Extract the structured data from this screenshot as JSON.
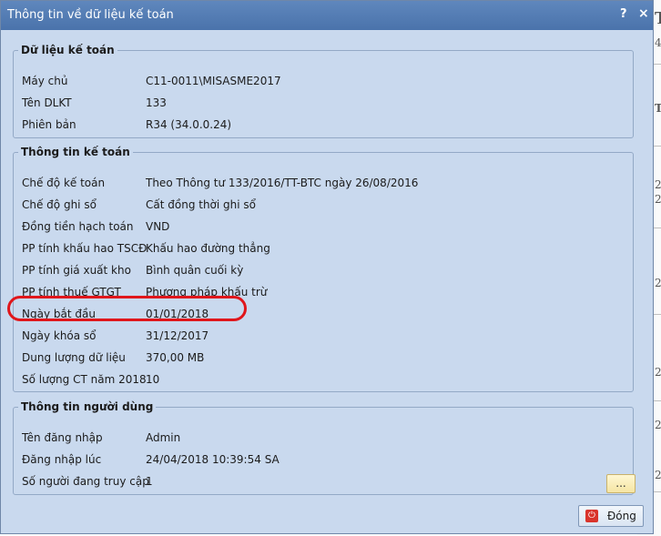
{
  "dialog": {
    "title": "Thông tin về dữ liệu kế toán",
    "help_glyph": "?",
    "close_glyph": "×"
  },
  "data_section": {
    "title": "Dữ liệu kế toán",
    "rows": [
      {
        "label": "Máy chủ",
        "value": "C11-0011\\MISASME2017"
      },
      {
        "label": "Tên DLKT",
        "value": "133"
      },
      {
        "label": "Phiên bản",
        "value": "R34 (34.0.0.24)"
      }
    ]
  },
  "accounting_section": {
    "title": "Thông tin kế toán",
    "rows": [
      {
        "label": "Chế độ kế toán",
        "value": "Theo Thông tư 133/2016/TT-BTC ngày 26/08/2016"
      },
      {
        "label": "Chế độ ghi sổ",
        "value": "Cất đồng thời ghi sổ"
      },
      {
        "label": "Đồng tiền hạch toán",
        "value": "VND"
      },
      {
        "label": "PP tính khấu hao TSCĐ",
        "value": "Khấu hao đường thẳng"
      },
      {
        "label": "PP tính giá xuất kho",
        "value": "Bình quân cuối kỳ"
      },
      {
        "label": "PP tính thuế GTGT",
        "value": "Phương pháp khấu trừ"
      },
      {
        "label": "Ngày bắt đầu",
        "value": "01/01/2018"
      },
      {
        "label": "Ngày khóa sổ",
        "value": "31/12/2017"
      },
      {
        "label": "Dung lượng dữ liệu",
        "value": "370,00 MB"
      },
      {
        "label": "Số lượng CT năm 2018",
        "value": "10"
      }
    ]
  },
  "user_section": {
    "title": "Thông tin người dùng",
    "rows": [
      {
        "label": "Tên đăng nhập",
        "value": "Admin"
      },
      {
        "label": "Đăng nhập lúc",
        "value": "24/04/2018 10:39:54 SA"
      },
      {
        "label": "Số người đang truy cập",
        "value": "1"
      }
    ],
    "more_button_label": "..."
  },
  "footer": {
    "close_button_label": "Đóng",
    "close_button_icon": "power-icon"
  },
  "background": {
    "fragments": [
      "T",
      "4",
      "T",
      "2",
      "2",
      "2",
      "2",
      "2",
      "2"
    ]
  },
  "colors": {
    "titlebar": "#4a73ab",
    "dialog_bg": "#c9d9ee",
    "highlight": "#e0161b"
  }
}
